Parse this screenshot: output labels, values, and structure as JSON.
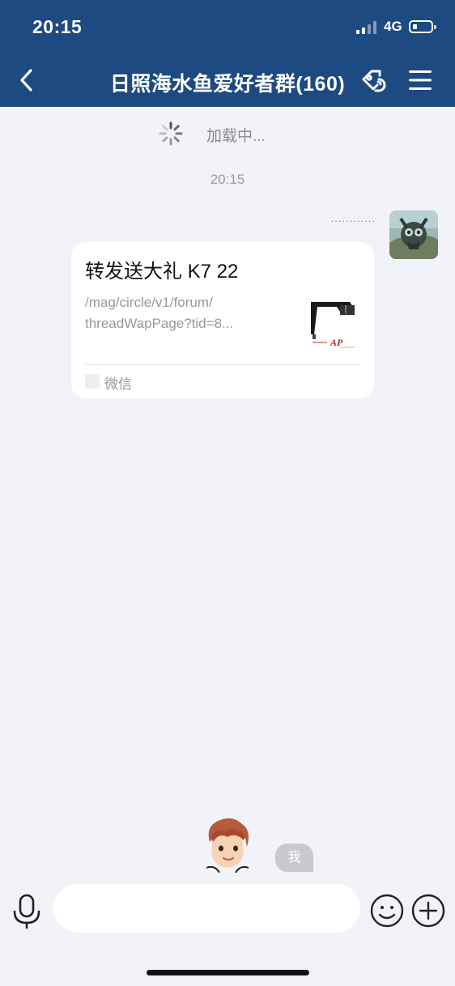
{
  "status_bar": {
    "time": "20:15",
    "network": "4G"
  },
  "header": {
    "title": "日照海水鱼爱好者群(160)"
  },
  "chat": {
    "loading_text": "加载中...",
    "timestamp": "20:15",
    "message": {
      "sender": "............",
      "card": {
        "title": "转发送大礼 K7 22",
        "desc_line1": "/mag/circle/v1/forum/",
        "desc_line2": "threadWapPage?tid=8...",
        "source": "微信"
      }
    },
    "me_label": "我"
  },
  "input": {
    "placeholder": ""
  },
  "colors": {
    "header_bg": "#1d4a80",
    "chat_bg": "#f2f3f8",
    "card_bg": "#ffffff"
  }
}
